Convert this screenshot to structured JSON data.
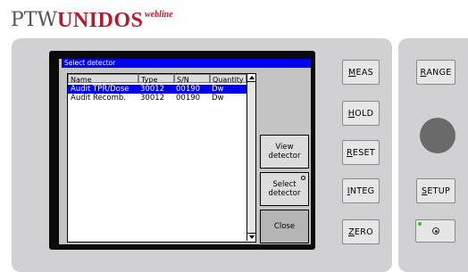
{
  "brand": {
    "ptw": "PTW",
    "product": "UNIDOS",
    "edition": "webline"
  },
  "dialog": {
    "title": "Select detector",
    "columns": [
      "Name",
      "Type",
      "S/N",
      "Quantity"
    ],
    "rows": [
      {
        "name": "Audit TPR/Dose",
        "type": "30012",
        "sn": "00190",
        "quantity": "Dw",
        "selected": true
      },
      {
        "name": "Audit Recomb.",
        "type": "30012",
        "sn": "00190",
        "quantity": "Dw",
        "selected": false
      }
    ],
    "softkeys": {
      "view": "View\ndetector",
      "select": "Select\ndetector",
      "close": "Close"
    }
  },
  "keys": {
    "meas": {
      "first": "M",
      "rest": "EAS"
    },
    "hold": {
      "first": "H",
      "rest": "OLD"
    },
    "reset": {
      "first": "R",
      "rest": "ESET"
    },
    "integ": {
      "first": "I",
      "rest": "NTEG"
    },
    "zero": {
      "first": "Z",
      "rest": "ERO"
    },
    "range": {
      "first": "R",
      "rest": "ANGE"
    },
    "setup": {
      "first": "S",
      "rest": "ETUP"
    }
  },
  "colors": {
    "brand_red": "#b01e2e",
    "selection_blue": "#0000ee",
    "power_led": "#2ec62e"
  }
}
